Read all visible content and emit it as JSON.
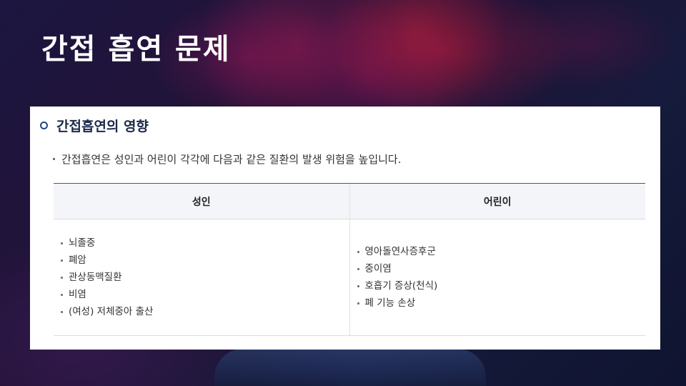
{
  "slide": {
    "title": "간접 흡연 문제"
  },
  "card": {
    "heading": "간접흡연의 영향",
    "intro": "간접흡연은 성인과 어린이 각각에 다음과 같은 질환의 발생 위험을 높입니다.",
    "table": {
      "columns": [
        "성인",
        "어린이"
      ],
      "adult_items": [
        "뇌졸중",
        "폐암",
        "관상동맥질환",
        "비염",
        "(여성) 저체중아 출산"
      ],
      "child_items": [
        "영아돌연사증후군",
        "중이염",
        "호흡기 증상(천식)",
        "폐 기능 손상"
      ]
    }
  },
  "colors": {
    "heading_accent": "#1f4a8a",
    "background_dark": "#16183a",
    "card_background": "#ffffff"
  }
}
